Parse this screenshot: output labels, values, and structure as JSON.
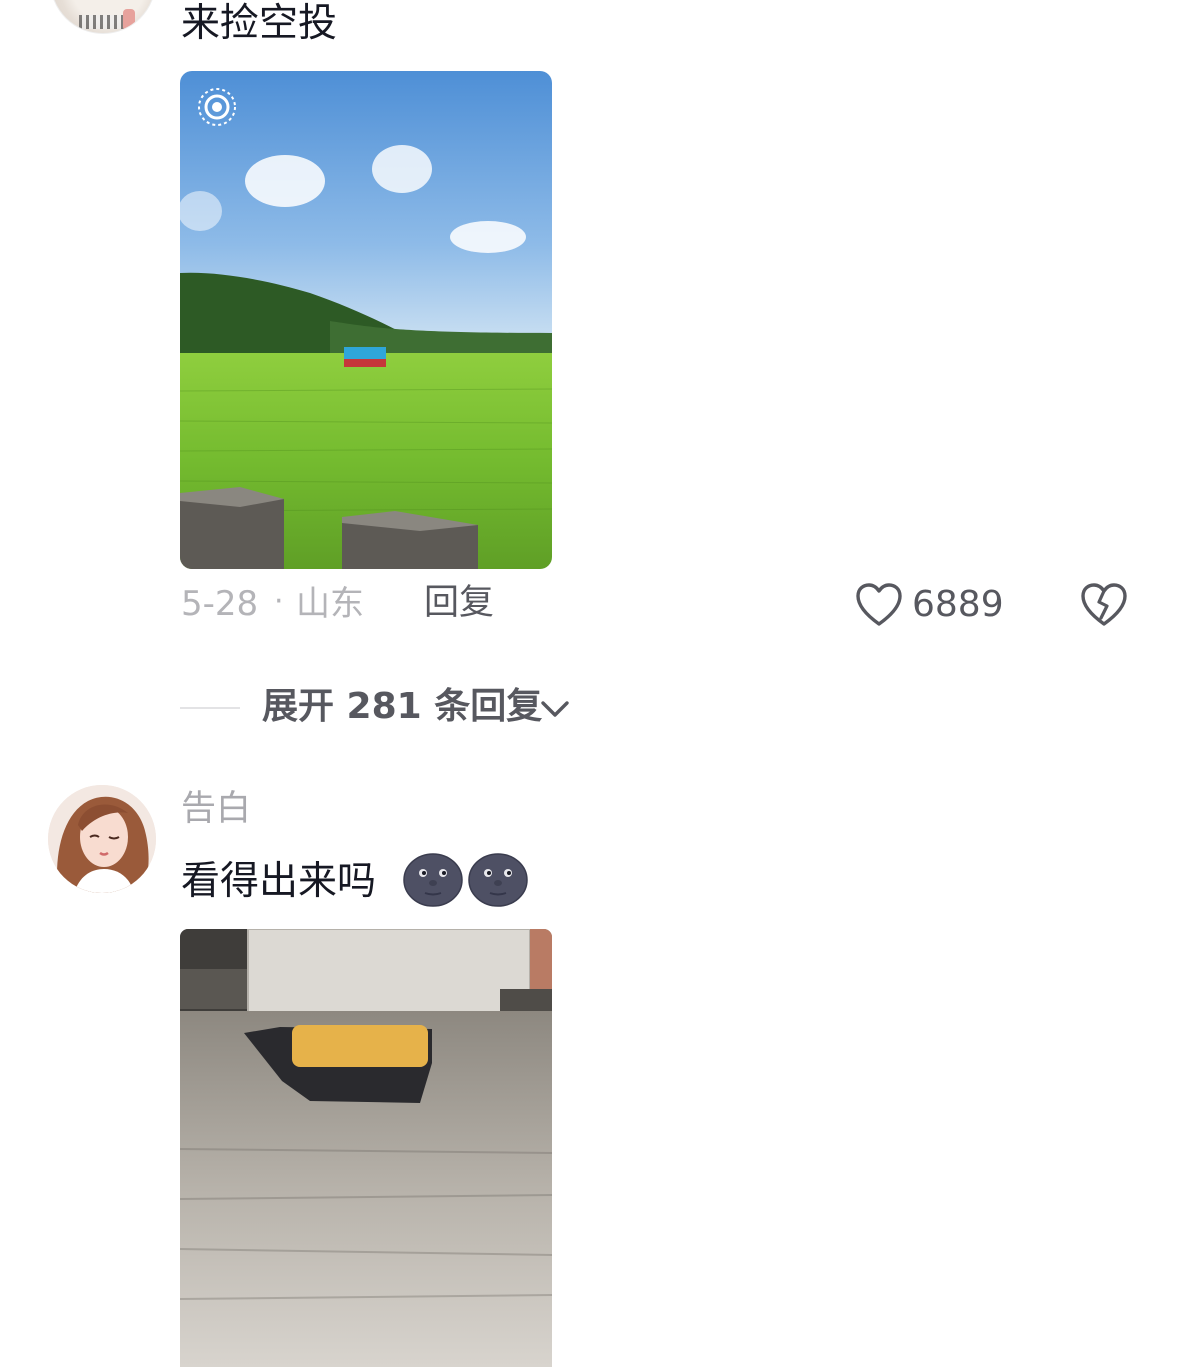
{
  "comment_1": {
    "text": "来捡空投",
    "date": "5-28",
    "separator": "·",
    "location": "山东",
    "reply_label": "回复",
    "likes": "6889",
    "expand_label": "展开 281 条回复",
    "image_icon": "live-photo-icon"
  },
  "comment_2": {
    "username": "告白",
    "text": "看得出来吗",
    "emojis": [
      "new-moon-face-icon",
      "new-moon-face-icon"
    ]
  },
  "icons": {
    "like": "heart-outline-icon",
    "dislike": "broken-heart-icon",
    "expand": "chevron-down-icon"
  },
  "colors": {
    "primary_text": "#161823",
    "secondary_text": "#b4b4b8",
    "action_text": "#57585f"
  }
}
